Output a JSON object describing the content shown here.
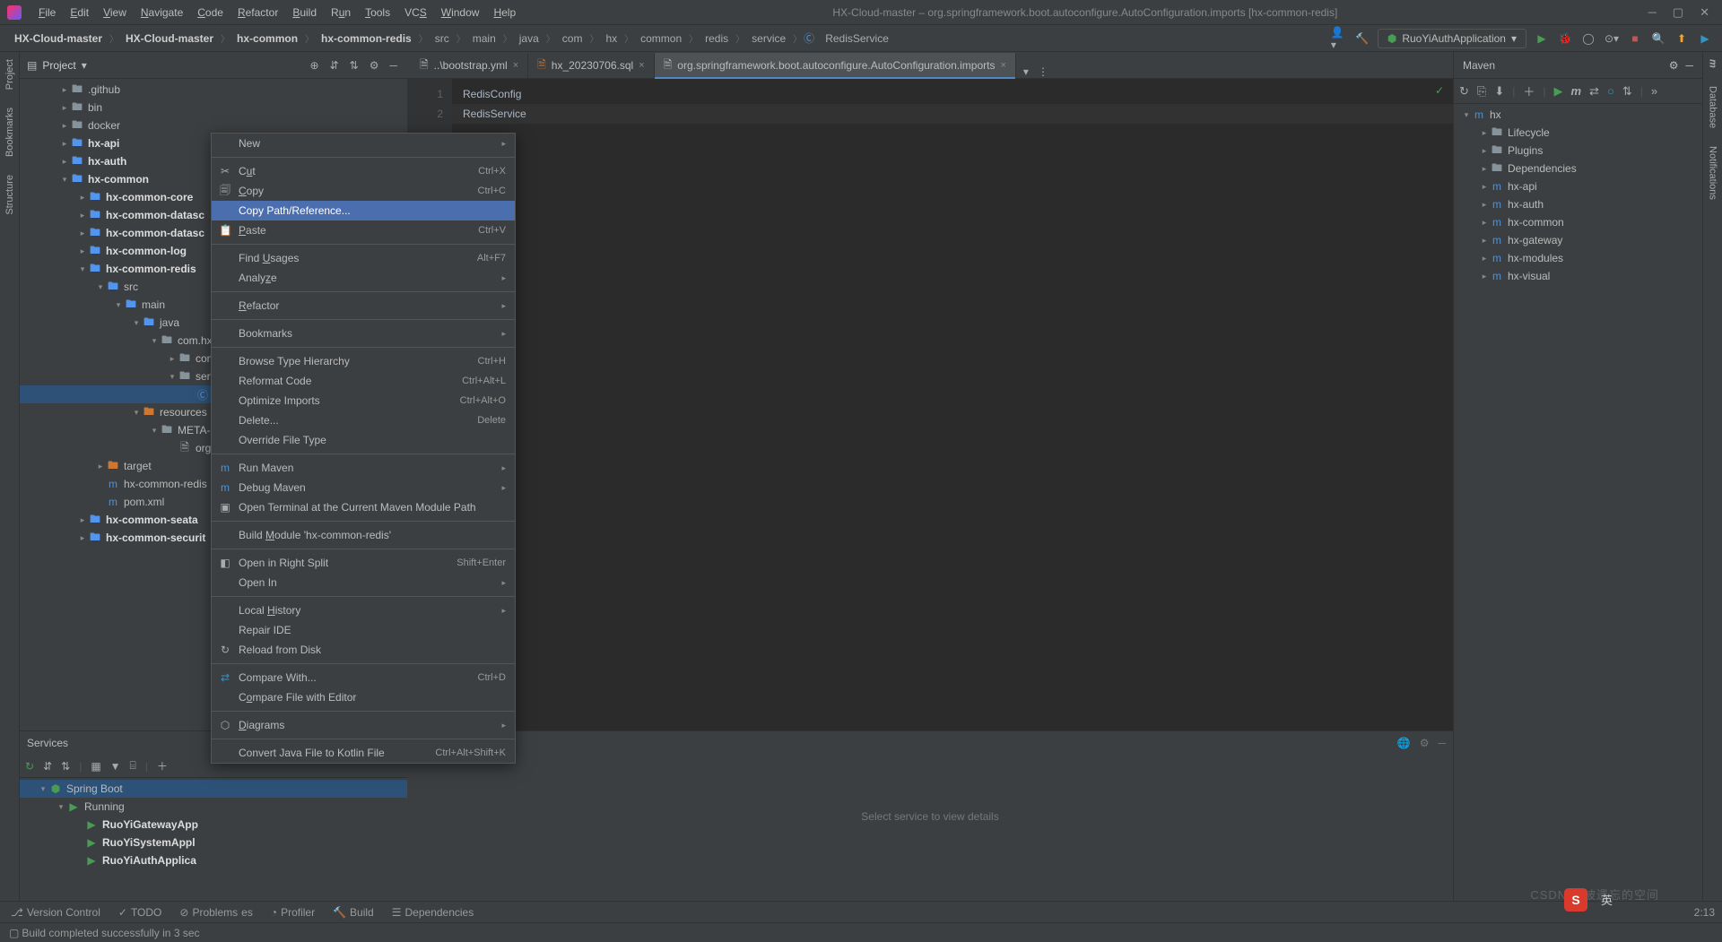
{
  "title": "HX-Cloud-master – org.springframework.boot.autoconfigure.AutoConfiguration.imports [hx-common-redis]",
  "menus": [
    "File",
    "Edit",
    "View",
    "Navigate",
    "Code",
    "Refactor",
    "Build",
    "Run",
    "Tools",
    "VCS",
    "Window",
    "Help"
  ],
  "breadcrumb": [
    "HX-Cloud-master",
    "HX-Cloud-master",
    "hx-common",
    "hx-common-redis",
    "src",
    "main",
    "java",
    "com",
    "hx",
    "common",
    "redis",
    "service",
    "RedisService"
  ],
  "runConfig": "RuoYiAuthApplication",
  "projectTool": "Project",
  "tree": {
    "github": ".github",
    "bin": "bin",
    "docker": "docker",
    "hxapi": "hx-api",
    "hxauth": "hx-auth",
    "hxcommon": "hx-common",
    "core": "hx-common-core",
    "ds1": "hx-common-datasc",
    "ds2": "hx-common-datasc",
    "log": "hx-common-log",
    "redis": "hx-common-redis",
    "src": "src",
    "main": "main",
    "java": "java",
    "comhx": "com.hx.",
    "confi": "confi",
    "servi": "servi",
    "re": "Re",
    "resources": "resources",
    "meta": "META-IN",
    "orgs": "org.s",
    "target": "target",
    "hxcr": "hx-common-redis",
    "pom": "pom.xml",
    "seata": "hx-common-seata",
    "security": "hx-common-securit"
  },
  "services": {
    "title": "Services",
    "sb": "Spring Boot",
    "run": "Running",
    "g": "RuoYiGatewayApp",
    "s": "RuoYiSystemAppl",
    "a": "RuoYiAuthApplica",
    "detail": "Select service to view details"
  },
  "tabs": {
    "t1": "..\\bootstrap.yml",
    "t2": "hx_20230706.sql",
    "t3": "org.springframework.boot.autoconfigure.AutoConfiguration.imports"
  },
  "editor": {
    "l1": "RedisConfig",
    "l2": "RedisService",
    "n1": "1",
    "n2": "2"
  },
  "maven": {
    "title": "Maven",
    "root": "hx",
    "life": "Lifecycle",
    "plug": "Plugins",
    "deps": "Dependencies",
    "api": "hx-api",
    "auth": "hx-auth",
    "common": "hx-common",
    "gw": "hx-gateway",
    "mod": "hx-modules",
    "vis": "hx-visual"
  },
  "ctx": {
    "new": "New",
    "cut": "Cut",
    "copy": "Copy",
    "cpr": "Copy Path/Reference...",
    "paste": "Paste",
    "fu": "Find Usages",
    "an": "Analyze",
    "rf": "Refactor",
    "bm": "Bookmarks",
    "bth": "Browse Type Hierarchy",
    "rc": "Reformat Code",
    "oi": "Optimize Imports",
    "del": "Delete...",
    "oft": "Override File Type",
    "rm": "Run Maven",
    "dm": "Debug Maven",
    "ot": "Open Terminal at the Current Maven Module Path",
    "bld": "Build Module 'hx-common-redis'",
    "ors": "Open in Right Split",
    "oin": "Open In",
    "lh": "Local History",
    "ri": "Repair IDE",
    "rd": "Reload from Disk",
    "cw": "Compare With...",
    "cfe": "Compare File with Editor",
    "dg": "Diagrams",
    "cjk": "Convert Java File to Kotlin File",
    "sc_cut": "Ctrl+X",
    "sc_copy": "Ctrl+C",
    "sc_paste": "Ctrl+V",
    "sc_fu": "Alt+F7",
    "sc_bth": "Ctrl+H",
    "sc_rc": "Ctrl+Alt+L",
    "sc_oi": "Ctrl+Alt+O",
    "sc_del": "Delete",
    "sc_ors": "Shift+Enter",
    "sc_cw": "Ctrl+D",
    "sc_cjk": "Ctrl+Alt+Shift+K"
  },
  "bottom": {
    "vc": "Version Control",
    "todo": "TODO",
    "pr": "Problems",
    "prof": "Profiler",
    "build": "Build",
    "deps": "Dependencies",
    "pos": "2:13"
  },
  "statusMsg": "Build completed successfully in 3 sec",
  "leftStrip": [
    "Project",
    "Bookmarks",
    "Structure"
  ],
  "rightStrip": [
    "Maven",
    "Database",
    "Notifications"
  ],
  "watermark": "CSDN @被遗忘的空间",
  "ime": "S",
  "imeTxt": "英"
}
